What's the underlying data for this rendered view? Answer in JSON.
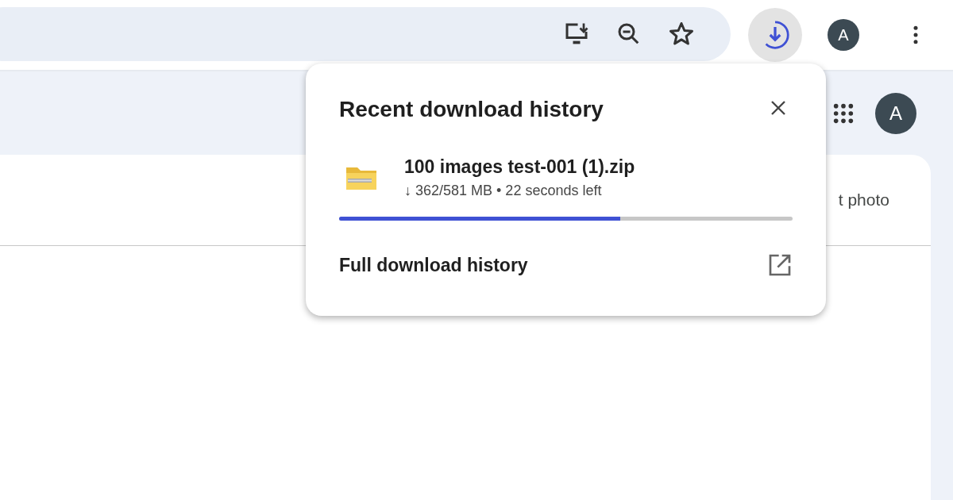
{
  "toolbar": {
    "profile_initial": "A"
  },
  "page": {
    "profile_initial": "A",
    "card_header_text": "t photo"
  },
  "download_popup": {
    "title": "Recent download history",
    "item": {
      "file_name": "100 images test-001 (1).zip",
      "status": "↓ 362/581 MB • 22 seconds left",
      "level": 0.62
    },
    "footer_link": "Full download history"
  }
}
